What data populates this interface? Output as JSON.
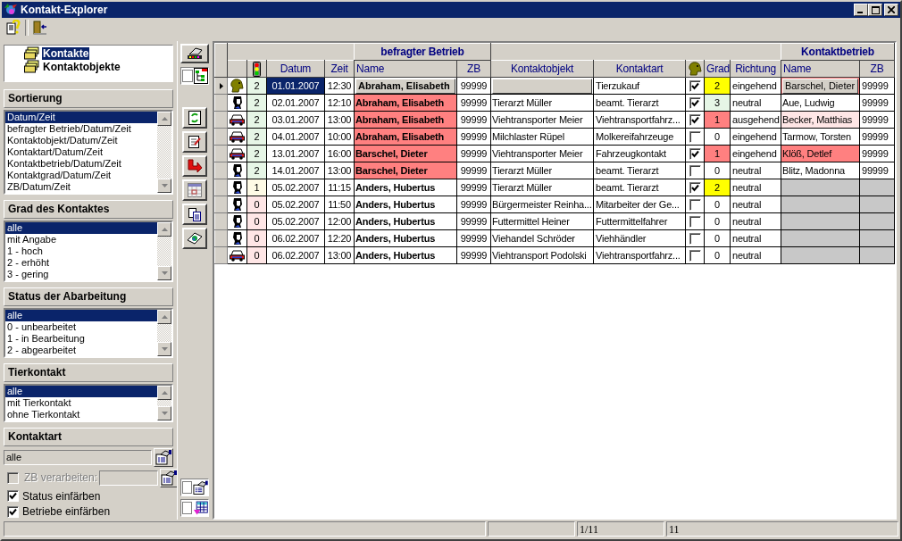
{
  "window": {
    "title": "Kontakt-Explorer"
  },
  "tree": [
    {
      "label": "Kontakte",
      "selected": true
    },
    {
      "label": "Kontaktobjekte",
      "selected": false
    }
  ],
  "filters": [
    {
      "title": "Sortierung",
      "items": [
        {
          "label": "Datum/Zeit",
          "selected": true
        },
        {
          "label": "befragter Betrieb/Datum/Zeit",
          "selected": false
        },
        {
          "label": "Kontaktobjekt/Datum/Zeit",
          "selected": false
        },
        {
          "label": "Kontaktart/Datum/Zeit",
          "selected": false
        },
        {
          "label": "Kontaktbetrieb/Datum/Zeit",
          "selected": false
        },
        {
          "label": "Kontaktgrad/Datum/Zeit",
          "selected": false
        },
        {
          "label": "ZB/Datum/Zeit",
          "selected": false
        }
      ]
    },
    {
      "title": "Grad des Kontaktes",
      "items": [
        {
          "label": "alle",
          "selected": true
        },
        {
          "label": "mit Angabe",
          "selected": false
        },
        {
          "label": "1 - hoch",
          "selected": false
        },
        {
          "label": "2 - erhöht",
          "selected": false
        },
        {
          "label": "3 - gering",
          "selected": false
        }
      ]
    },
    {
      "title": "Status der Abarbeitung",
      "items": [
        {
          "label": "alle",
          "selected": true
        },
        {
          "label": "0 - unbearbeitet",
          "selected": false
        },
        {
          "label": "1 - in Bearbeitung",
          "selected": false
        },
        {
          "label": "2 - abgearbeitet",
          "selected": false
        }
      ]
    },
    {
      "title": "Tierkontakt",
      "items": [
        {
          "label": "alle",
          "selected": true
        },
        {
          "label": "mit Tierkontakt",
          "selected": false
        },
        {
          "label": "ohne Tierkontakt",
          "selected": false
        }
      ]
    }
  ],
  "kontaktart": {
    "title": "Kontaktart",
    "value": "alle"
  },
  "zb_verarbeiten": {
    "label": "ZB verarbeiten:",
    "checked": false,
    "disabled": true
  },
  "options": [
    {
      "label": "Status einfärben",
      "checked": true
    },
    {
      "label": "Betriebe einfärben",
      "checked": true
    }
  ],
  "top_toggle": {
    "checked": false
  },
  "bottom_toggles": [
    {
      "kind": "form",
      "checked": false
    },
    {
      "kind": "grid",
      "checked": false
    }
  ],
  "grid": {
    "groups": [
      {
        "label": "befragter Betrieb"
      },
      {
        "label": "Kontaktbetrieb"
      }
    ],
    "columns": [
      {
        "kind": "blank"
      },
      {
        "kind": "light"
      },
      {
        "kind": "text",
        "label": "Datum"
      },
      {
        "kind": "text",
        "label": "Zeit"
      },
      {
        "kind": "text",
        "label": "Name"
      },
      {
        "kind": "text",
        "label": "ZB"
      },
      {
        "kind": "text",
        "label": "Kontaktobjekt"
      },
      {
        "kind": "text",
        "label": "Kontaktart"
      },
      {
        "kind": "animal"
      },
      {
        "kind": "text",
        "label": "Grad"
      },
      {
        "kind": "text",
        "label": "Richtung"
      },
      {
        "kind": "text",
        "label": "Name"
      },
      {
        "kind": "text",
        "label": "ZB"
      }
    ],
    "rows": [
      {
        "kind": "dog",
        "selected": true,
        "status": {
          "text": "2",
          "color": "#e6f6e6"
        },
        "datum": "01.01.2007",
        "zeit": "12:30",
        "name": {
          "text": "Abraham, Elisabeth"
        },
        "zb": "99999",
        "kontaktart": "Tierzukauf",
        "tierkontakt": true,
        "grad": {
          "text": "2",
          "color": "#ffff00"
        },
        "richtung": "eingehend",
        "kontakt": {
          "name": "Barschel, Dieter",
          "color": "#ff8080",
          "zb": "99999"
        }
      },
      {
        "kind": "person",
        "selected": false,
        "status": {
          "text": "2",
          "color": "#e6f6e6"
        },
        "datum": "02.01.2007",
        "zeit": "12:10",
        "name": {
          "text": "Abraham, Elisabeth",
          "color": "#ff8080"
        },
        "zb": "99999",
        "kontaktobjekt": "Tierarzt Müller",
        "kontaktart": "beamt. Tierarzt",
        "tierkontakt": true,
        "grad": {
          "text": "3",
          "color": "#e6f6e6"
        },
        "richtung": "neutral",
        "kontakt": {
          "name": "Aue, Ludwig",
          "zb": "99999"
        }
      },
      {
        "kind": "car",
        "selected": false,
        "status": {
          "text": "2",
          "color": "#e6f6e6"
        },
        "datum": "03.01.2007",
        "zeit": "13:00",
        "name": {
          "text": "Abraham, Elisabeth",
          "color": "#ff8080"
        },
        "zb": "99999",
        "kontaktobjekt": "Viehtransporter Meier",
        "kontaktart": "Viehtransportfahrz...",
        "tierkontakt": true,
        "grad": {
          "text": "1",
          "color": "#ff8080"
        },
        "richtung": "ausgehend",
        "kontakt": {
          "name": "Becker, Matthias",
          "color": "#ffe6e6",
          "zb": "99999"
        }
      },
      {
        "kind": "car",
        "selected": false,
        "status": {
          "text": "2",
          "color": "#e6f6e6"
        },
        "datum": "04.01.2007",
        "zeit": "10:00",
        "name": {
          "text": "Abraham, Elisabeth",
          "color": "#ff8080"
        },
        "zb": "99999",
        "kontaktobjekt": "Milchlaster Rüpel",
        "kontaktart": "Molkereifahrzeuge",
        "tierkontakt": false,
        "grad": {
          "text": "0"
        },
        "richtung": "eingehend",
        "kontakt": {
          "name": "Tarmow, Torsten",
          "zb": "99999"
        }
      },
      {
        "kind": "car",
        "selected": false,
        "status": {
          "text": "2",
          "color": "#e6f6e6"
        },
        "datum": "13.01.2007",
        "zeit": "16:00",
        "name": {
          "text": "Barschel, Dieter",
          "color": "#ff8080"
        },
        "zb": "99999",
        "kontaktobjekt": "Viehtransporter Meier",
        "kontaktart": "Fahrzeugkontakt",
        "tierkontakt": true,
        "grad": {
          "text": "1",
          "color": "#ff8080"
        },
        "richtung": "eingehend",
        "kontakt": {
          "name": "Klöß, Detlef",
          "color": "#ff8080",
          "zb": "99999"
        }
      },
      {
        "kind": "person",
        "selected": false,
        "status": {
          "text": "2",
          "color": "#e6f6e6"
        },
        "datum": "14.01.2007",
        "zeit": "13:00",
        "name": {
          "text": "Barschel, Dieter",
          "color": "#ff8080"
        },
        "zb": "99999",
        "kontaktobjekt": "Tierarzt Müller",
        "kontaktart": "beamt. Tierarzt",
        "tierkontakt": false,
        "grad": {
          "text": "0"
        },
        "richtung": "neutral",
        "kontakt": {
          "name": "Blitz, Madonna",
          "zb": "99999"
        }
      },
      {
        "kind": "person",
        "selected": false,
        "status": {
          "text": "1",
          "color": "#fffbe6"
        },
        "datum": "05.02.2007",
        "zeit": "11:15",
        "name": {
          "text": "Anders, Hubertus"
        },
        "zb": "99999",
        "kontaktobjekt": "Tierarzt Müller",
        "kontaktart": "beamt. Tierarzt",
        "tierkontakt": true,
        "grad": {
          "text": "2",
          "color": "#ffff00"
        },
        "richtung": "neutral"
      },
      {
        "kind": "person",
        "selected": false,
        "status": {
          "text": "0",
          "color": "#ffe6e6"
        },
        "datum": "05.02.2007",
        "zeit": "11:50",
        "name": {
          "text": "Anders, Hubertus"
        },
        "zb": "99999",
        "kontaktobjekt": "Bürgermeister Reinha...",
        "kontaktart": "Mitarbeiter der Ge...",
        "tierkontakt": false,
        "grad": {
          "text": "0"
        },
        "richtung": "neutral"
      },
      {
        "kind": "person",
        "selected": false,
        "status": {
          "text": "0",
          "color": "#ffe6e6"
        },
        "datum": "05.02.2007",
        "zeit": "12:00",
        "name": {
          "text": "Anders, Hubertus"
        },
        "zb": "99999",
        "kontaktobjekt": "Futtermittel Heiner",
        "kontaktart": "Futtermittelfahrer",
        "tierkontakt": false,
        "grad": {
          "text": "0"
        },
        "richtung": "neutral"
      },
      {
        "kind": "person",
        "selected": false,
        "status": {
          "text": "0",
          "color": "#ffe6e6"
        },
        "datum": "06.02.2007",
        "zeit": "12:20",
        "name": {
          "text": "Anders, Hubertus"
        },
        "zb": "99999",
        "kontaktobjekt": "Viehandel Schröder",
        "kontaktart": "Viehhändler",
        "tierkontakt": false,
        "grad": {
          "text": "0"
        },
        "richtung": "neutral"
      },
      {
        "kind": "car",
        "selected": false,
        "status": {
          "text": "0",
          "color": "#ffe6e6"
        },
        "datum": "06.02.2007",
        "zeit": "13:00",
        "name": {
          "text": "Anders, Hubertus"
        },
        "zb": "99999",
        "kontaktobjekt": "Viehtransport Podolski",
        "kontaktart": "Viehtransportfahrz...",
        "tierkontakt": false,
        "grad": {
          "text": "0"
        },
        "richtung": "neutral"
      }
    ]
  },
  "status_bar": {
    "position": "1/11",
    "count": "11"
  }
}
